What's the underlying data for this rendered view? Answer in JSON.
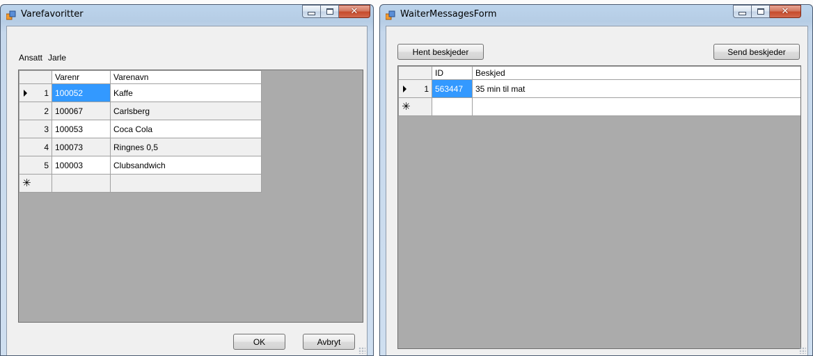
{
  "left_window": {
    "title": "Varefavoritter",
    "ansatt_label": "Ansatt",
    "ansatt_value": "Jarle",
    "columns": [
      "Varenr",
      "Varenavn"
    ],
    "rows": [
      {
        "num": "1",
        "varenr": "100052",
        "varenavn": "Kaffe"
      },
      {
        "num": "2",
        "varenr": "100067",
        "varenavn": "Carlsberg"
      },
      {
        "num": "3",
        "varenr": "100053",
        "varenavn": "Coca Cola"
      },
      {
        "num": "4",
        "varenr": "100073",
        "varenavn": "Ringnes 0,5"
      },
      {
        "num": "5",
        "varenr": "100003",
        "varenavn": "Clubsandwich"
      }
    ],
    "new_row_marker": "✳",
    "ok_label": "OK",
    "cancel_label": "Avbryt",
    "close_glyph": "✕"
  },
  "right_window": {
    "title": "WaiterMessagesForm",
    "fetch_label": "Hent beskjeder",
    "send_label": "Send beskjeder",
    "columns": [
      "ID",
      "Beskjed"
    ],
    "rows": [
      {
        "num": "1",
        "id": "563447",
        "beskjed": "35 min til mat"
      }
    ],
    "new_row_marker": "✳",
    "close_glyph": "✕"
  },
  "colors": {
    "selection": "#3399ff",
    "grid_background": "#ababab",
    "form_background": "#f0f0f0",
    "close_button": "#c64b2c"
  }
}
